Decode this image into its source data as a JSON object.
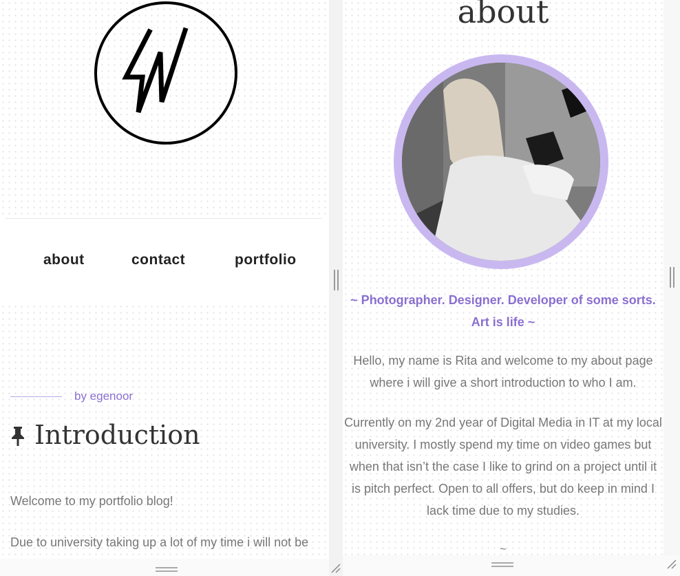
{
  "left_panel": {
    "nav": {
      "items": [
        {
          "label": "about"
        },
        {
          "label": "contact"
        },
        {
          "label": "portfolio"
        }
      ]
    },
    "post": {
      "author": "by egenoor",
      "title": "Introduction",
      "paragraphs": [
        "Welcome to my portfolio blog!",
        "Due to university taking up a lot of my time i will not be"
      ]
    }
  },
  "right_panel": {
    "title": "about",
    "tagline_lines": [
      "~ Photographer. Designer. Developer of some sorts.",
      "Art is life ~"
    ],
    "intro_lines": [
      "Hello, my name is Rita and welcome to my about page",
      "where i will give a short introduction to who I am."
    ],
    "bio_lines": [
      "Currently on my 2nd year of Digital Media in IT at my local",
      "university. I mostly spend my time on video games but",
      "when that isn’t the case I like to grind on a project until it",
      "is pitch perfect. Open to all offers, but do keep in mind I",
      "lack time due to my studies."
    ],
    "divider": "~"
  },
  "colors": {
    "accent": "#8a6fd0",
    "avatar_ring": "#c9b8f0",
    "body_text": "#777777",
    "heading_text": "#333333"
  },
  "icons": {
    "logo": "lightning-w-logo-icon",
    "pin": "pushpin-icon"
  }
}
